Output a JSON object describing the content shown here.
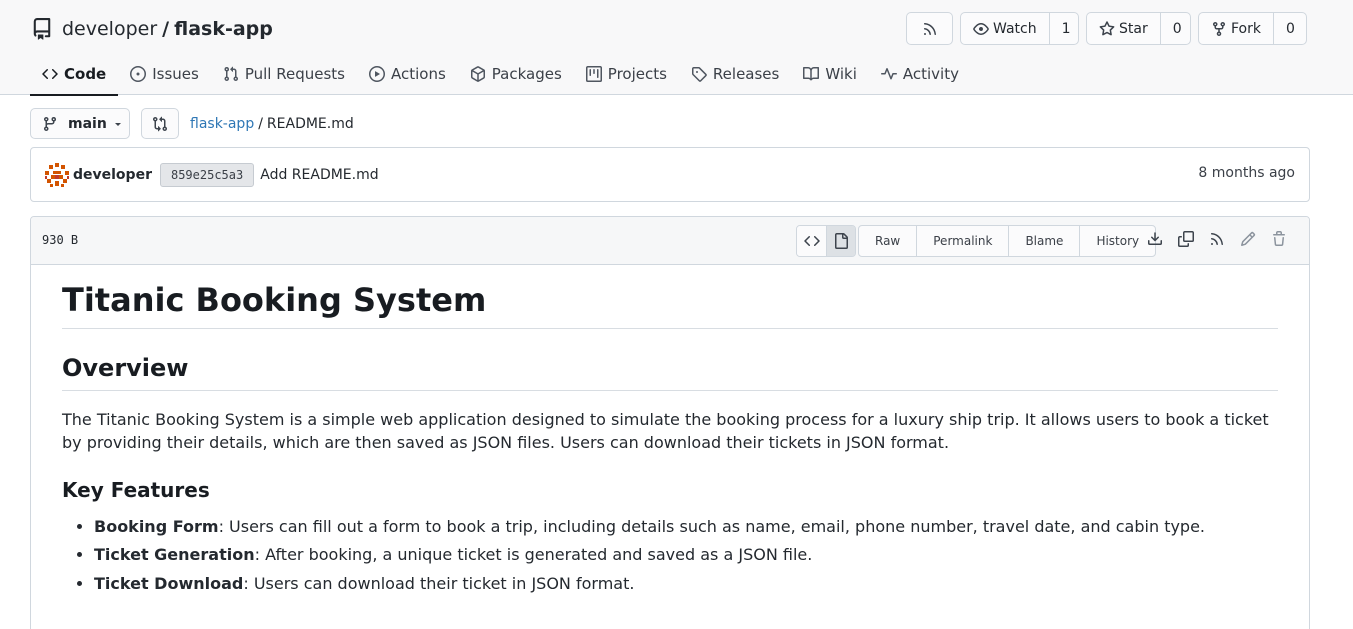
{
  "repo": {
    "owner": "developer",
    "separator": "/",
    "name": "flask-app"
  },
  "header_buttons": {
    "watch_label": "Watch",
    "watch_count": "1",
    "star_label": "Star",
    "star_count": "0",
    "fork_label": "Fork",
    "fork_count": "0"
  },
  "tabs": [
    {
      "label": "Code",
      "icon": "code-icon",
      "active": true
    },
    {
      "label": "Issues",
      "icon": "issue-icon"
    },
    {
      "label": "Pull Requests",
      "icon": "pull-request-icon"
    },
    {
      "label": "Actions",
      "icon": "play-icon"
    },
    {
      "label": "Packages",
      "icon": "package-icon"
    },
    {
      "label": "Projects",
      "icon": "project-icon"
    },
    {
      "label": "Releases",
      "icon": "tag-icon"
    },
    {
      "label": "Wiki",
      "icon": "book-icon"
    },
    {
      "label": "Activity",
      "icon": "pulse-icon"
    }
  ],
  "branch": {
    "name": "main"
  },
  "breadcrumb": {
    "repo_link": "flask-app",
    "separator": "/",
    "file": "README.md"
  },
  "commit": {
    "author": "developer",
    "sha": "859e25c5a3",
    "message": "Add README.md",
    "time": "8 months ago"
  },
  "file": {
    "size": "930 B",
    "actions": [
      "Raw",
      "Permalink",
      "Blame",
      "History"
    ]
  },
  "readme": {
    "title": "Titanic Booking System",
    "overview_heading": "Overview",
    "overview_text": "The Titanic Booking System is a simple web application designed to simulate the booking process for a luxury ship trip. It allows users to book a ticket by providing their details, which are then saved as JSON files. Users can download their tickets in JSON format.",
    "features_heading": "Key Features",
    "features": [
      {
        "name": "Booking Form",
        "text": ": Users can fill out a form to book a trip, including details such as name, email, phone number, travel date, and cabin type."
      },
      {
        "name": "Ticket Generation",
        "text": ": After booking, a unique ticket is generated and saved as a JSON file."
      },
      {
        "name": "Ticket Download",
        "text": ": Users can download their ticket in JSON format."
      }
    ]
  },
  "colors": {
    "link": "#2f77b5",
    "border": "#d0d7de",
    "header_bg": "#f8f8f9",
    "text": "#181c21"
  }
}
